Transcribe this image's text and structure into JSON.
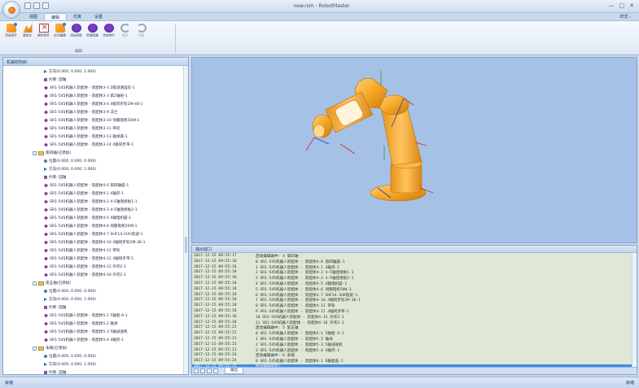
{
  "window": {
    "title": "new.rsm - RobotMaster",
    "controls": [
      "—",
      "□",
      "✕"
    ]
  },
  "ribbon": {
    "tabs": [
      "视图",
      "编辑",
      "仿真",
      "设置"
    ],
    "active_tab": 1,
    "right_label": "样式 -",
    "group_label": "编辑",
    "buttons": [
      {
        "label": "添加连杆",
        "icon": "add-link-icon",
        "disabled": false
      },
      {
        "label": "重定位",
        "icon": "relocate-icon",
        "disabled": false
      },
      {
        "label": "删除连杆",
        "icon": "delete-link-icon",
        "disabled": false
      },
      {
        "label": "启动编辑",
        "icon": "start-edit-icon",
        "disabled": false
      },
      {
        "label": "添加伺服",
        "icon": "add-servo-icon",
        "disabled": false
      },
      {
        "label": "新建机器",
        "icon": "new-robot-icon",
        "disabled": false
      },
      {
        "label": "添加零件",
        "icon": "add-part-icon",
        "disabled": false
      },
      {
        "label": "撤销",
        "icon": "undo-icon",
        "disabled": true
      },
      {
        "label": "恢复",
        "icon": "redo-icon",
        "disabled": true
      }
    ]
  },
  "left_panel": {
    "title": "机械结构树",
    "rows": [
      {
        "indent": 3,
        "icon": "dir",
        "text": "方向(0.000, 0.000, 1.000)"
      },
      {
        "indent": 3,
        "icon": "cons",
        "text": "约束: 固轴"
      },
      {
        "indent": 3,
        "icon": "joint",
        "text": "SR1-545机器人装配体 - 装配体3-3 2级减速齿轮-1"
      },
      {
        "indent": 3,
        "icon": "joint",
        "text": "SR1-545机器人装配体 - 装配体3-3 第2轴组-1"
      },
      {
        "indent": 3,
        "icon": "joint",
        "text": "SR1-545机器人装配体 - 装配体3-4 4级同步轮2M-48-1"
      },
      {
        "indent": 3,
        "icon": "joint",
        "text": "SR1-545机器人装配体 - 装配体3-9 法兰"
      },
      {
        "indent": 3,
        "icon": "joint",
        "text": "SR1-545机器人装配体 - 装配体3-10 伺服电机50W-1"
      },
      {
        "indent": 3,
        "icon": "joint",
        "text": "SR1-545机器人装配体 - 装配体3-11 带轮"
      },
      {
        "indent": 3,
        "icon": "joint",
        "text": "SR1-545机器人装配体 - 装配体3-13 轴承座-1"
      },
      {
        "indent": 3,
        "icon": "joint",
        "text": "SR1-545机器人装配体 - 装配体3-14 4级同步带-1"
      },
      {
        "indent": 2,
        "icon": "folder",
        "text": "第四轴(已添加)",
        "expander": "-"
      },
      {
        "indent": 3,
        "icon": "pos",
        "text": "位置(0.000, 0.000, 0.000)"
      },
      {
        "indent": 3,
        "icon": "dir",
        "text": "方向(0.000, 0.000, 1.000)"
      },
      {
        "indent": 3,
        "icon": "cons",
        "text": "约束: 固轴"
      },
      {
        "indent": 3,
        "icon": "joint",
        "text": "SR1-545机器人装配体 - 装配体4-0 第四轴座-1"
      },
      {
        "indent": 3,
        "icon": "joint",
        "text": "SR1-545机器人装配体 - 装配体4-1 4轴壳-1"
      },
      {
        "indent": 3,
        "icon": "joint",
        "text": "SR1-545机器人装配体 - 装配体4-2 4-5轴连接板1-1"
      },
      {
        "indent": 3,
        "icon": "joint",
        "text": "SR1-545机器人装配体 - 装配体4-3 4-5轴连接板2-1"
      },
      {
        "indent": 3,
        "icon": "joint",
        "text": "SR1-545机器人装配体 - 装配体4-5 4轴电机座-1"
      },
      {
        "indent": 3,
        "icon": "joint",
        "text": "SR1-545机器人装配体 - 装配体4-6 伺服电机50W-1"
      },
      {
        "indent": 3,
        "icon": "joint",
        "text": "SR1-545机器人装配体 - 装配体4-7 SHF14-2UH谐波-1"
      },
      {
        "indent": 3,
        "icon": "joint",
        "text": "SR1-545机器人装配体 - 装配体4-10 4轴同步轮2M-36-1"
      },
      {
        "indent": 3,
        "icon": "joint",
        "text": "SR1-545机器人装配体 - 装配体4-11 带轮"
      },
      {
        "indent": 3,
        "icon": "joint",
        "text": "SR1-545机器人装配体 - 装配体4-12 4轴同步带-1"
      },
      {
        "indent": 3,
        "icon": "joint",
        "text": "SR1-545机器人装配体 - 装配体4-15 外壳2-1"
      },
      {
        "indent": 3,
        "icon": "joint",
        "text": "SR1-545机器人装配体 - 装配体4-16 外壳2-1"
      },
      {
        "indent": 2,
        "icon": "folder",
        "text": "第五轴(已添加)",
        "expander": "-"
      },
      {
        "indent": 3,
        "icon": "pos",
        "text": "位置(0.000, 0.000, 0.000)"
      },
      {
        "indent": 3,
        "icon": "dir",
        "text": "方向(0.000, 0.000, 1.000)"
      },
      {
        "indent": 3,
        "icon": "cons",
        "text": "约束: 固轴"
      },
      {
        "indent": 3,
        "icon": "joint",
        "text": "SR1-545机器人装配体 - 装配体5-1 5轴套-A-1"
      },
      {
        "indent": 3,
        "icon": "joint",
        "text": "SR1-545机器人装配体 - 装配体5-2 轴承"
      },
      {
        "indent": 3,
        "icon": "joint",
        "text": "SR1-545机器人装配体 - 装配体5-3 5轴减速机"
      },
      {
        "indent": 3,
        "icon": "joint",
        "text": "SR1-545机器人装配体 - 装配体5-4 4轴壳-1"
      },
      {
        "indent": 2,
        "icon": "folder",
        "text": "末端(已添加)",
        "expander": "-"
      },
      {
        "indent": 3,
        "icon": "pos",
        "text": "位置(0.000, 0.000, 0.000)"
      },
      {
        "indent": 3,
        "icon": "dir",
        "text": "方向(0.000, 0.000, 1.000)"
      },
      {
        "indent": 3,
        "icon": "cons",
        "text": "约束: 固轴"
      },
      {
        "indent": 3,
        "icon": "joint",
        "text": "SR1-545机器人装配体 - 装配体6-1 6轴套盖-1"
      }
    ]
  },
  "output_panel": {
    "title": "输出窗口",
    "tab_label": "输出",
    "lines": [
      {
        "time": "2017-12-15 09:55:17",
        "text": "启动编辑器中: 4  第四轴"
      },
      {
        "time": "2017-12-15 09:55:18",
        "text": "0   SR1-545机器人装配体 - 装配体4-0 第四轴座-1"
      },
      {
        "time": "2017-12-15 09:55:18",
        "text": "1   SR1-545机器人装配体 - 装配体4-1 4轴壳-1"
      },
      {
        "time": "2017-12-15 09:55:18",
        "text": "2   SR1-545机器人装配体 - 装配体4-2 4-5轴连接板1-1"
      },
      {
        "time": "2017-12-15 09:55:18",
        "text": "3   SR1-545机器人装配体 - 装配体4-3 4-5轴连接板2-1"
      },
      {
        "time": "2017-12-15 09:55:18",
        "text": "4   SR1-545机器人装配体 - 装配体4-5 4轴电机座-1"
      },
      {
        "time": "2017-12-15 09:55:18",
        "text": "5   SR1-545机器人装配体 - 装配体4-6 伺服电机50W-1"
      },
      {
        "time": "2017-12-15 09:55:18",
        "text": "6   SR1-545机器人装配体 - 装配体4-7 SHF14-2UH谐波-1"
      },
      {
        "time": "2017-12-15 09:55:18",
        "text": "7   SR1-545机器人装配体 - 装配体4-10 4轴同步轮2M-36-1"
      },
      {
        "time": "2017-12-15 09:55:18",
        "text": "8   SR1-545机器人装配体 - 装配体4-11 带轮"
      },
      {
        "time": "2017-12-15 09:55:18",
        "text": "9   SR1-545机器人装配体 - 装配体4-12 4轴同步带-1"
      },
      {
        "time": "2017-12-15 09:55:18",
        "text": "10  SR1-545机器人装配体 - 装配体4-15 外壳2-1"
      },
      {
        "time": "2017-12-15 09:55:18",
        "text": "11  SR1-545机器人装配体 - 装配体4-16 外壳2-1"
      },
      {
        "time": "2017-12-15 09:55:21",
        "text": "启动编辑器中: 5  第五轴"
      },
      {
        "time": "2017-12-15 09:55:21",
        "text": "0   SR1-545机器人装配体 - 装配体5-1 5轴套-A-1"
      },
      {
        "time": "2017-12-15 09:55:21",
        "text": "1   SR1-545机器人装配体 - 装配体5-2 轴承"
      },
      {
        "time": "2017-12-15 09:55:21",
        "text": "2   SR1-545机器人装配体 - 装配体5-3 5轴减速机"
      },
      {
        "time": "2017-12-15 09:55:21",
        "text": "3   SR1-545机器人装配体 - 装配体5-4 4轴壳-1"
      },
      {
        "time": "2017-12-15 09:55:24",
        "text": "启动编辑器中: 6  末端"
      },
      {
        "time": "2017-12-15 09:55:24",
        "text": "0   SR1-545机器人装配体 - 装配体6-1 6轴套盖-1"
      },
      {
        "time": "2017-12-15 09:55:25",
        "text": "启动编辑完成!",
        "selected": true
      }
    ]
  },
  "statusbar": {
    "left": "就绪",
    "right": "就绪"
  },
  "colors": {
    "robot": "#f5a623",
    "viewport_bg": "#a6c1e6",
    "output_bg": "#dfe7d6",
    "selection": "#3a8ee8"
  }
}
